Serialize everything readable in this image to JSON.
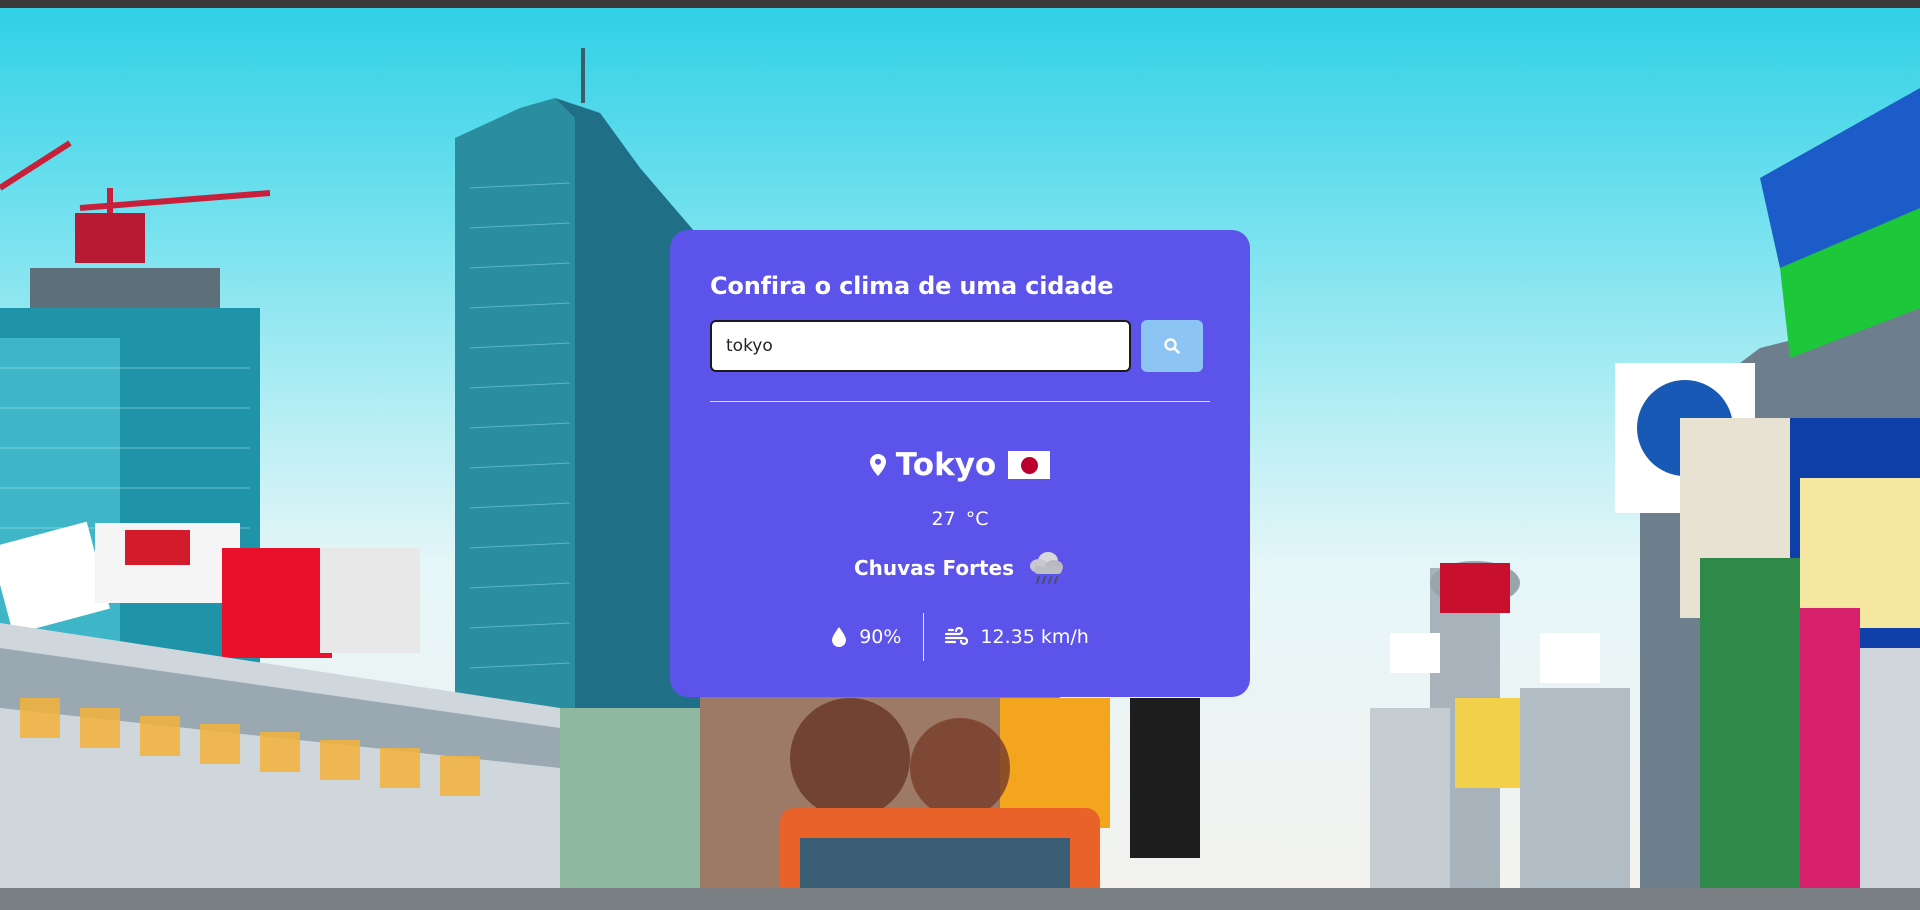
{
  "app": {
    "heading": "Confira o clima de uma cidade"
  },
  "search": {
    "value": "tokyo",
    "placeholder": "",
    "button_icon": "search-icon"
  },
  "weather": {
    "city": "Tokyo",
    "country_flag": "japan-flag",
    "temperature": "27",
    "unit": "°C",
    "condition": "Chuvas Fortes",
    "condition_icon": "rain-cloud-icon",
    "humidity": "90%",
    "humidity_icon": "droplet-icon",
    "wind": "12.35 km/h",
    "wind_icon": "wind-icon"
  },
  "colors": {
    "card_bg": "#5b53ea",
    "button_bg": "#8cc5f3",
    "text": "#ffffff"
  }
}
